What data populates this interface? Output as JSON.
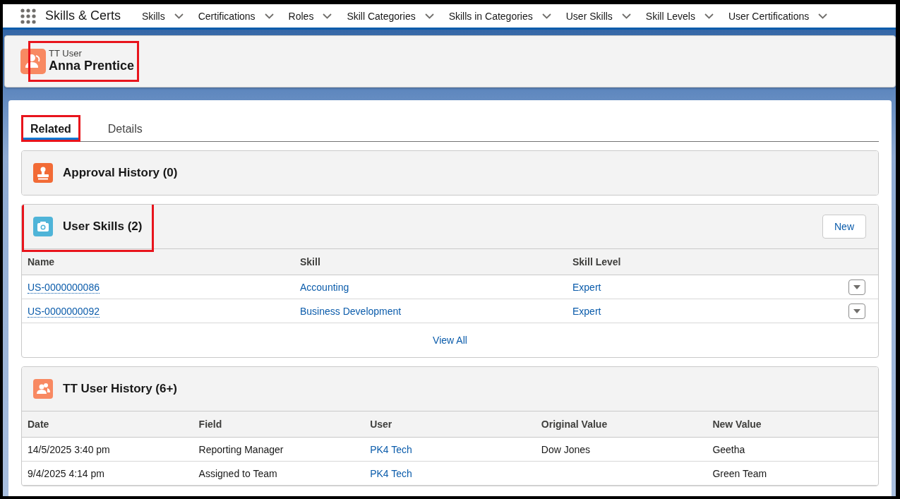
{
  "app": {
    "name": "Skills & Certs"
  },
  "nav": [
    {
      "label": "Skills"
    },
    {
      "label": "Certifications"
    },
    {
      "label": "Roles"
    },
    {
      "label": "Skill Categories"
    },
    {
      "label": "Skills in Categories"
    },
    {
      "label": "User Skills"
    },
    {
      "label": "Skill Levels"
    },
    {
      "label": "User Certifications"
    }
  ],
  "record": {
    "type": "TT User",
    "name": "Anna Prentice",
    "highlighted": true
  },
  "tabs": [
    {
      "label": "Related",
      "selected": true,
      "highlighted": true
    },
    {
      "label": "Details",
      "selected": false,
      "highlighted": false
    }
  ],
  "approval_history": {
    "title": "Approval History (0)"
  },
  "user_skills": {
    "title": "User Skills (2)",
    "highlighted": true,
    "new_button": "New",
    "columns": [
      {
        "label": "Name",
        "link": true,
        "dotted": true
      },
      {
        "label": "Skill",
        "link": true,
        "dotted": false
      },
      {
        "label": "Skill Level",
        "link": true,
        "dotted": false
      }
    ],
    "rows": [
      {
        "cells": [
          "US-0000000086",
          "Accounting",
          "Expert"
        ]
      },
      {
        "cells": [
          "US-0000000092",
          "Business Development",
          "Expert"
        ]
      }
    ],
    "view_all": "View All"
  },
  "history": {
    "title": "TT User History (6+)",
    "columns": [
      {
        "label": "Date",
        "link": false
      },
      {
        "label": "Field",
        "link": false
      },
      {
        "label": "User",
        "link": true
      },
      {
        "label": "Original Value",
        "link": false
      },
      {
        "label": "New Value",
        "link": false
      }
    ],
    "rows": [
      {
        "cells": [
          "14/5/2025 3:40 pm",
          "Reporting Manager",
          "PK4 Tech",
          "Dow Jones",
          "Geetha"
        ]
      },
      {
        "cells": [
          "9/4/2025 4:14 pm",
          "Assigned to Team",
          "PK4 Tech",
          null,
          "Green Team"
        ]
      }
    ]
  }
}
